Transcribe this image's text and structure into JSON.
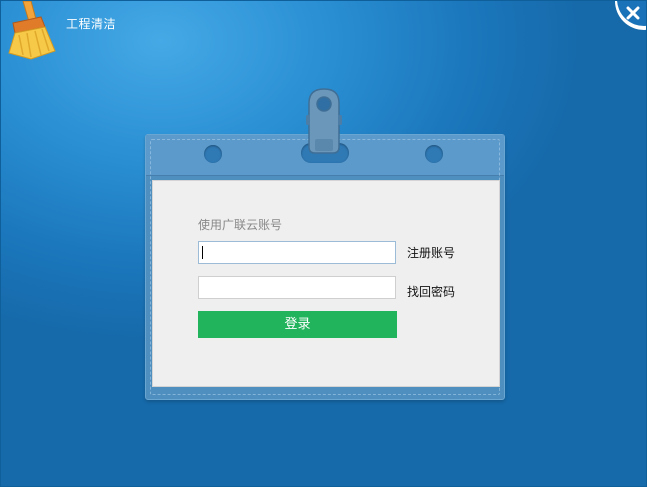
{
  "app": {
    "title": "工程清洁",
    "logo_icon": "broom-icon",
    "close_icon": "close-icon"
  },
  "login": {
    "account_label": "使用广联云账号",
    "account_value": "",
    "password_value": "",
    "register_link": "注册账号",
    "recover_link": "找回密码",
    "login_button": "登录"
  },
  "colors": {
    "background": "#1b76bb",
    "login_button": "#22b35d",
    "card": "#efefef"
  }
}
